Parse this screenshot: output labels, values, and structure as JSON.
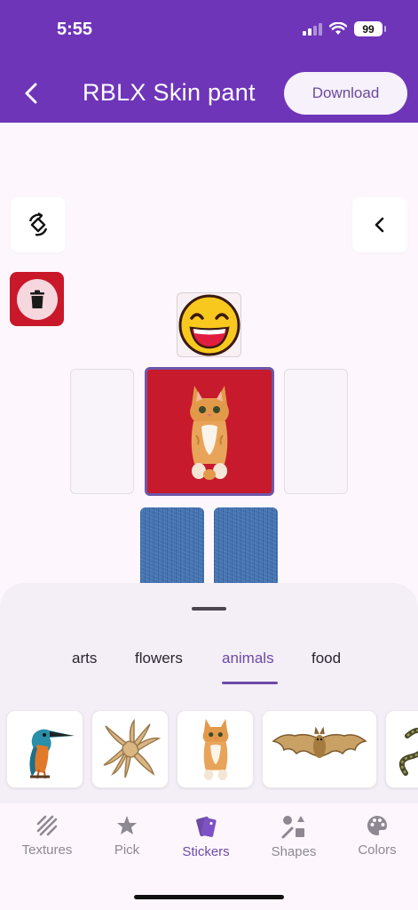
{
  "status_bar": {
    "time": "5:55",
    "battery": "99"
  },
  "header": {
    "title": "RBLX Skin pant",
    "download_label": "Download"
  },
  "tabs": {
    "categories": [
      {
        "label": "arts"
      },
      {
        "label": "flowers"
      },
      {
        "label": "animals"
      },
      {
        "label": "food"
      }
    ],
    "active": "animals"
  },
  "stickers": [
    "kingfisher-sticker",
    "starfish-sticker",
    "kitten-sticker",
    "bat-sticker",
    "snake-sticker"
  ],
  "bottom_nav": {
    "items": [
      {
        "label": "Textures",
        "icon": "texture-icon"
      },
      {
        "label": "Pick",
        "icon": "star-icon"
      },
      {
        "label": "Stickers",
        "icon": "stickers-icon"
      },
      {
        "label": "Shapes",
        "icon": "shapes-icon"
      },
      {
        "label": "Colors",
        "icon": "palette-icon"
      }
    ],
    "active": "Stickers"
  },
  "colors": {
    "header": "#6e35b9",
    "accent": "#6d4aa6",
    "torso": "#c71a2c",
    "delete": "#c8182a"
  }
}
